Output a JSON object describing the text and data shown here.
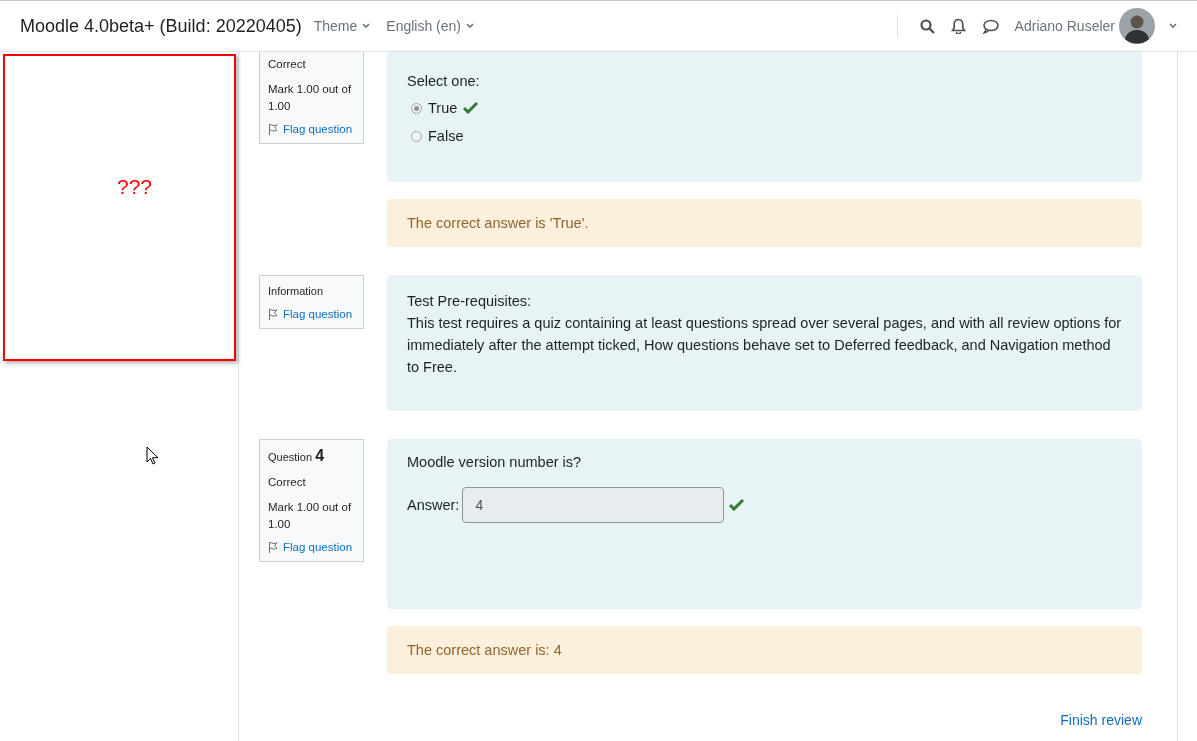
{
  "navbar": {
    "site_name": "Moodle 4.0beta+ (Build: 20220405)",
    "menus": [
      {
        "label": "Theme"
      },
      {
        "label": "English (en)"
      }
    ],
    "user_name": "Adriano Ruseler"
  },
  "sidebar": {
    "block_text": "???"
  },
  "questions": [
    {
      "kind": "truefalse",
      "info": {
        "state": "Correct",
        "mark": "Mark 1.00 out of 1.00",
        "flag": "Flag question"
      },
      "prompt": "Select one:",
      "options": [
        {
          "label": "True",
          "selected": true,
          "correct": true
        },
        {
          "label": "False",
          "selected": false,
          "correct": false
        }
      ],
      "feedback": "The correct answer is 'True'."
    },
    {
      "kind": "description",
      "info": {
        "type_label": "Information",
        "flag": "Flag question"
      },
      "heading": "Test Pre-requisites:",
      "text": "This test requires a quiz containing at least questions spread over several pages, and with all review options for immediately after the attempt ticked, How questions behave set to Deferred feedback, and Navigation method to Free."
    },
    {
      "kind": "shortanswer",
      "info": {
        "label": "Question",
        "number": "4",
        "state": "Correct",
        "mark": "Mark 1.00 out of 1.00",
        "flag": "Flag question"
      },
      "prompt": "Moodle version number is?",
      "answer_label": "Answer:",
      "answer_value": "4",
      "correct": true,
      "feedback": "The correct answer is: 4"
    }
  ],
  "finish_link": "Finish review"
}
